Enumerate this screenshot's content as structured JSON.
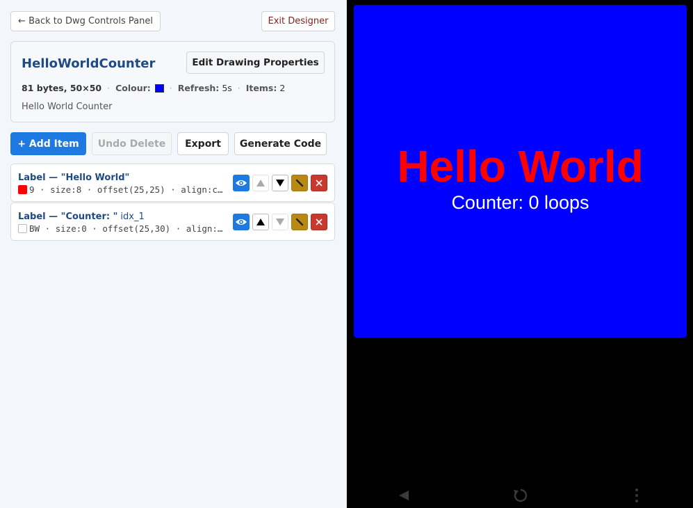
{
  "header": {
    "back_label": "← Back to Dwg Controls Panel",
    "exit_label": "Exit Designer"
  },
  "drawing": {
    "title": "HelloWorldCounter",
    "edit_label": "Edit Drawing Properties",
    "size_info": "81 bytes, 50×50",
    "colour_key": "Colour:",
    "colour": "#0000ff",
    "refresh_key": "Refresh:",
    "refresh_value": "5s",
    "items_key": "Items:",
    "items_value": "2",
    "description": "Hello World Counter"
  },
  "toolbar": {
    "add_label": "+ Add Item",
    "undo_label": "Undo Delete",
    "export_label": "Export",
    "generate_label": "Generate Code"
  },
  "items": [
    {
      "title": "Label — \"Hello World\"",
      "extra": "",
      "swatch_color": "#ff0000",
      "detail": "9 · size:8 · offset(25,25) · align:c…"
    },
    {
      "title": "Label — \"Counter: \"",
      "extra": "idx_1",
      "swatch_color": "none",
      "detail": "BW · size:0 · offset(25,30) · align:…"
    }
  ],
  "preview": {
    "background": "#0000ff",
    "line1": "Hello World",
    "line1_color": "#ff0000",
    "line2": "Counter: 0 loops",
    "line2_color": "#ffffff"
  },
  "navbar": {
    "icons": [
      "back-triangle-icon",
      "refresh-icon",
      "more-vert-icon"
    ]
  }
}
